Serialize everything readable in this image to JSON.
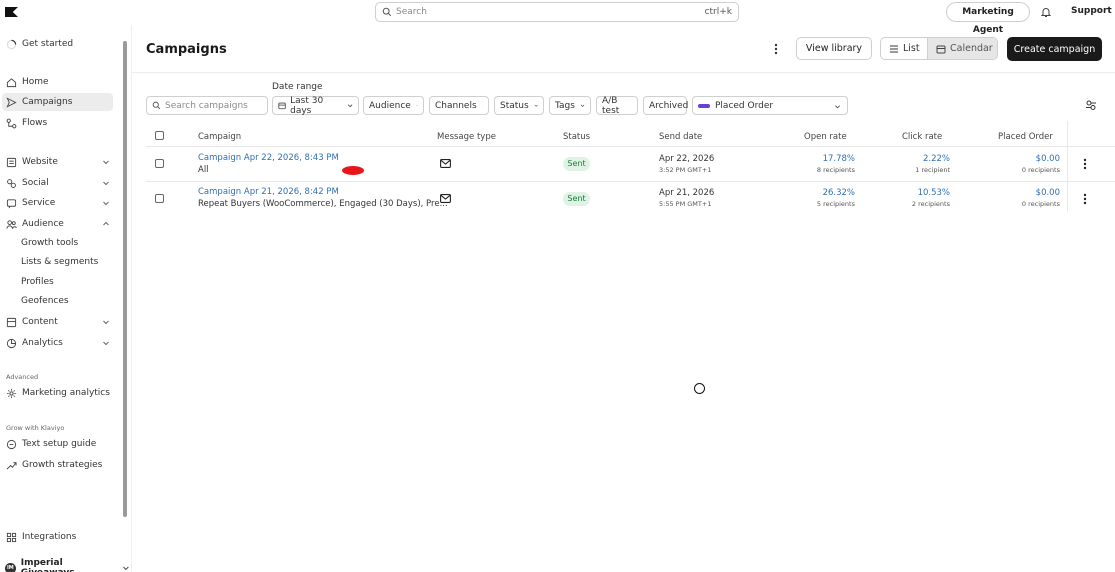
{
  "topbar": {
    "search_placeholder": "Search",
    "search_shortcut": "ctrl+k",
    "agent_button": "Marketing Agent",
    "support": "Support"
  },
  "sidebar": {
    "get_started": "Get started",
    "items": [
      {
        "label": "Home"
      },
      {
        "label": "Campaigns"
      },
      {
        "label": "Flows"
      },
      {
        "label": "Website"
      },
      {
        "label": "Social"
      },
      {
        "label": "Service"
      },
      {
        "label": "Audience"
      },
      {
        "label": "Content"
      },
      {
        "label": "Analytics"
      }
    ],
    "audience_sub": [
      "Growth tools",
      "Lists & segments",
      "Profiles",
      "Geofences"
    ],
    "section_advanced": "Advanced",
    "marketing_analytics": "Marketing analytics",
    "section_grow": "Grow with Klaviyo",
    "text_setup": "Text setup guide",
    "growth_strategies": "Growth strategies",
    "integrations": "Integrations",
    "workspace": "Imperial Giveaways",
    "workspace_initials": "IM"
  },
  "main": {
    "title": "Campaigns",
    "view_library": "View library",
    "view_list": "List",
    "view_calendar": "Calendar",
    "create_campaign": "Create campaign",
    "date_range_label": "Date range",
    "filters": {
      "search_placeholder": "Search campaigns",
      "date": "Last 30 days",
      "audience": "Audience",
      "channels": "Channels",
      "status": "Status",
      "tags": "Tags",
      "ab_test": "A/B test",
      "archived": "Archived",
      "metric": "Placed Order"
    },
    "columns": [
      "Campaign",
      "Message type",
      "Status",
      "Send date",
      "Open rate",
      "Click rate",
      "Placed Order"
    ],
    "rows": [
      {
        "name": "Campaign Apr 22, 2026, 8:43 PM",
        "audience": "All",
        "status": "Sent",
        "send_date": "Apr 22, 2026",
        "send_time": "3:52 PM GMT+1",
        "open_rate": "17.78%",
        "open_sub": "8 recipients",
        "click_rate": "2.22%",
        "click_sub": "1 recipient",
        "placed": "$0.00",
        "placed_sub": "0 recipients"
      },
      {
        "name": "Campaign Apr 21, 2026, 8:42 PM",
        "audience": "Repeat Buyers (WooCommerce), Engaged (30 Days), Pre...",
        "status": "Sent",
        "send_date": "Apr 21, 2026",
        "send_time": "5:55 PM GMT+1",
        "open_rate": "26.32%",
        "open_sub": "5 recipients",
        "click_rate": "10.53%",
        "click_sub": "2 recipients",
        "placed": "$0.00",
        "placed_sub": "0 recipients"
      }
    ]
  },
  "colors": {
    "link": "#2f6fb5",
    "primary_button": "#1a1a1a",
    "sent_badge_bg": "#dff3e4",
    "sent_badge_text": "#1f7a3a",
    "metric_badge": "#6a3fd1"
  }
}
